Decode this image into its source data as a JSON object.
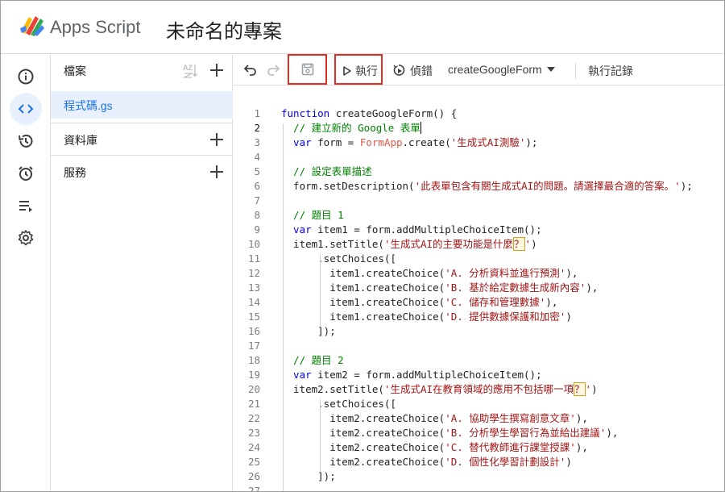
{
  "header": {
    "app_name": "Apps Script",
    "project_title": "未命名的專案",
    "logo_icon": "apps-script-logo"
  },
  "rail": {
    "items": [
      {
        "icon": "info-icon"
      },
      {
        "icon": "code-icon",
        "active": true
      },
      {
        "icon": "history-icon"
      },
      {
        "icon": "alarm-icon"
      },
      {
        "icon": "executions-icon"
      },
      {
        "icon": "settings-icon"
      }
    ]
  },
  "files": {
    "header_label": "檔案",
    "sort_icon_text": "AZ",
    "items": [
      {
        "name": "程式碼.gs",
        "selected": true
      }
    ],
    "sections": [
      {
        "label": "資料庫"
      },
      {
        "label": "服務"
      }
    ]
  },
  "toolbar": {
    "run_label": "執行",
    "debug_label": "偵錯",
    "function_select": "createGoogleForm",
    "log_label": "執行記錄",
    "highlight_color": "#d93025"
  },
  "editor": {
    "current_line": 2,
    "lines": [
      {
        "n": "1",
        "parts": [
          [
            "kw",
            "function "
          ],
          [
            "fn",
            "createGoogleForm() {"
          ]
        ]
      },
      {
        "n": "2",
        "parts": [
          [
            "cm",
            "  // 建立新的 Google 表單"
          ]
        ],
        "cursor": true
      },
      {
        "n": "3",
        "parts": [
          [
            "kw",
            "  var "
          ],
          [
            "fn",
            "form = "
          ],
          [
            "cl",
            "FormApp"
          ],
          [
            "fn",
            ".create("
          ],
          [
            "st",
            "'生成式AI測驗'"
          ],
          [
            "fn",
            ");"
          ]
        ]
      },
      {
        "n": "4",
        "parts": []
      },
      {
        "n": "5",
        "parts": [
          [
            "cm",
            "  // 設定表單描述"
          ]
        ]
      },
      {
        "n": "6",
        "parts": [
          [
            "fn",
            "  form.setDescription("
          ],
          [
            "st",
            "'此表單包含有關生成式AI的問題。請選擇最合適的答案。'"
          ],
          [
            "fn",
            ");"
          ]
        ]
      },
      {
        "n": "7",
        "parts": []
      },
      {
        "n": "8",
        "parts": [
          [
            "cm",
            "  // 題目 1"
          ]
        ]
      },
      {
        "n": "9",
        "parts": [
          [
            "kw",
            "  var "
          ],
          [
            "fn",
            "item1 = form.addMultipleChoiceItem();"
          ]
        ]
      },
      {
        "n": "10",
        "parts": [
          [
            "fn",
            "  item1.setTitle("
          ],
          [
            "st",
            "'生成式AI的主要功能是什麼"
          ],
          [
            "q",
            "？"
          ],
          [
            "st",
            "'"
          ],
          [
            "fn",
            ")"
          ]
        ]
      },
      {
        "n": "11",
        "parts": [
          [
            "fn",
            "      .setChoices(["
          ]
        ]
      },
      {
        "n": "12",
        "parts": [
          [
            "fn",
            "        item1.createChoice("
          ],
          [
            "st",
            "'A. 分析資料並進行預測'"
          ],
          [
            "fn",
            "),"
          ]
        ]
      },
      {
        "n": "13",
        "parts": [
          [
            "fn",
            "        item1.createChoice("
          ],
          [
            "st",
            "'B. 基於給定數據生成新內容'"
          ],
          [
            "fn",
            "),"
          ]
        ]
      },
      {
        "n": "14",
        "parts": [
          [
            "fn",
            "        item1.createChoice("
          ],
          [
            "st",
            "'C. 儲存和管理數據'"
          ],
          [
            "fn",
            "),"
          ]
        ]
      },
      {
        "n": "15",
        "parts": [
          [
            "fn",
            "        item1.createChoice("
          ],
          [
            "st",
            "'D. 提供數據保護和加密'"
          ],
          [
            "fn",
            ")"
          ]
        ]
      },
      {
        "n": "16",
        "parts": [
          [
            "fn",
            "      ]);"
          ]
        ]
      },
      {
        "n": "17",
        "parts": []
      },
      {
        "n": "18",
        "parts": [
          [
            "cm",
            "  // 題目 2"
          ]
        ]
      },
      {
        "n": "19",
        "parts": [
          [
            "kw",
            "  var "
          ],
          [
            "fn",
            "item2 = form.addMultipleChoiceItem();"
          ]
        ]
      },
      {
        "n": "20",
        "parts": [
          [
            "fn",
            "  item2.setTitle("
          ],
          [
            "st",
            "'生成式AI在教育領域的應用不包括哪一項"
          ],
          [
            "q",
            "？"
          ],
          [
            "st",
            "'"
          ],
          [
            "fn",
            ")"
          ]
        ]
      },
      {
        "n": "21",
        "parts": [
          [
            "fn",
            "      .setChoices(["
          ]
        ]
      },
      {
        "n": "22",
        "parts": [
          [
            "fn",
            "        item2.createChoice("
          ],
          [
            "st",
            "'A. 協助學生撰寫創意文章'"
          ],
          [
            "fn",
            "),"
          ]
        ]
      },
      {
        "n": "23",
        "parts": [
          [
            "fn",
            "        item2.createChoice("
          ],
          [
            "st",
            "'B. 分析學生學習行為並給出建議'"
          ],
          [
            "fn",
            "),"
          ]
        ]
      },
      {
        "n": "24",
        "parts": [
          [
            "fn",
            "        item2.createChoice("
          ],
          [
            "st",
            "'C. 替代教師進行課堂授課'"
          ],
          [
            "fn",
            "),"
          ]
        ]
      },
      {
        "n": "25",
        "parts": [
          [
            "fn",
            "        item2.createChoice("
          ],
          [
            "st",
            "'D. 個性化學習計劃設計'"
          ],
          [
            "fn",
            ")"
          ]
        ]
      },
      {
        "n": "26",
        "parts": [
          [
            "fn",
            "      ]);"
          ]
        ]
      },
      {
        "n": "27",
        "parts": []
      }
    ]
  }
}
